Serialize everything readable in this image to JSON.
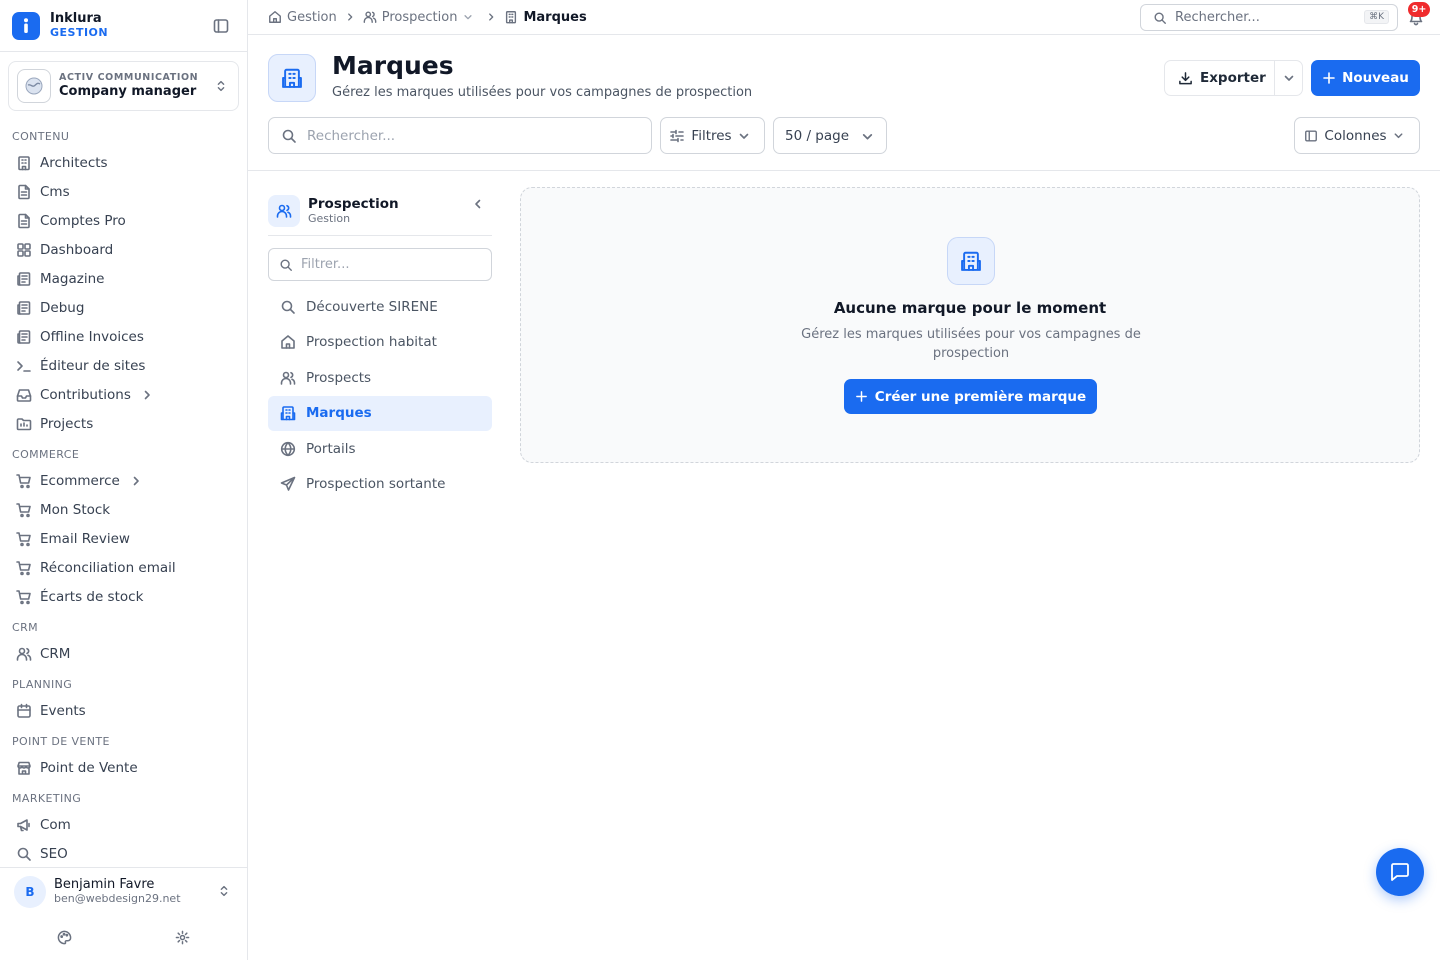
{
  "brand": {
    "name": "Inklura",
    "sub": "GESTION",
    "accent": "#1a6bf0"
  },
  "org": {
    "label": "ACTIV COMMUNICATION",
    "name": "Company manager"
  },
  "sidebar": {
    "sections": [
      {
        "title": "CONTENU",
        "items": [
          {
            "label": "Architects",
            "icon": "building-icon"
          },
          {
            "label": "Cms",
            "icon": "file-icon"
          },
          {
            "label": "Comptes Pro",
            "icon": "file-icon"
          },
          {
            "label": "Dashboard",
            "icon": "grid-icon"
          },
          {
            "label": "Magazine",
            "icon": "newspaper-icon"
          },
          {
            "label": "Debug",
            "icon": "newspaper-icon"
          },
          {
            "label": "Offline Invoices",
            "icon": "newspaper-icon"
          },
          {
            "label": "Éditeur de sites",
            "icon": "terminal-icon"
          },
          {
            "label": "Contributions",
            "icon": "inbox-icon",
            "chevron": true
          },
          {
            "label": "Projects",
            "icon": "folder-icon"
          }
        ]
      },
      {
        "title": "COMMERCE",
        "items": [
          {
            "label": "Ecommerce",
            "icon": "cart-icon",
            "chevron": true
          },
          {
            "label": "Mon Stock",
            "icon": "cart-icon"
          },
          {
            "label": "Email Review",
            "icon": "cart-icon"
          },
          {
            "label": "Réconciliation email",
            "icon": "cart-icon"
          },
          {
            "label": "Écarts de stock",
            "icon": "cart-icon"
          }
        ]
      },
      {
        "title": "CRM",
        "items": [
          {
            "label": "CRM",
            "icon": "users-icon"
          }
        ]
      },
      {
        "title": "PLANNING",
        "items": [
          {
            "label": "Events",
            "icon": "calendar-icon"
          }
        ]
      },
      {
        "title": "POINT DE VENTE",
        "items": [
          {
            "label": "Point de Vente",
            "icon": "store-icon"
          }
        ]
      },
      {
        "title": "MARKETING",
        "items": [
          {
            "label": "Com",
            "icon": "megaphone-icon"
          },
          {
            "label": "SEO",
            "icon": "search-icon"
          }
        ]
      }
    ]
  },
  "user": {
    "initial": "B",
    "name": "Benjamin Favre",
    "email": "ben@webdesign29.net"
  },
  "breadcrumb": [
    {
      "label": "Gestion",
      "icon": "home-icon"
    },
    {
      "label": "Prospection",
      "icon": "users-icon",
      "dropdown": true
    },
    {
      "label": "Marques",
      "icon": "building-icon"
    }
  ],
  "top_search": {
    "placeholder": "Rechercher...",
    "shortcut": "⌘K"
  },
  "notifications": {
    "badge": "9+"
  },
  "page": {
    "title": "Marques",
    "subtitle": "Gérez les marques utilisées pour vos campagnes de prospection",
    "export_label": "Exporter",
    "new_label": "Nouveau",
    "search_placeholder": "Rechercher...",
    "filters_label": "Filtres",
    "page_size": "50 / page",
    "columns_label": "Colonnes"
  },
  "subnav": {
    "title": "Prospection",
    "sub": "Gestion",
    "filter_placeholder": "Filtrer...",
    "items": [
      {
        "label": "Découverte SIRENE",
        "icon": "search-icon"
      },
      {
        "label": "Prospection habitat",
        "icon": "home-icon"
      },
      {
        "label": "Prospects",
        "icon": "users-icon"
      },
      {
        "label": "Marques",
        "icon": "building-icon",
        "active": true
      },
      {
        "label": "Portails",
        "icon": "globe-icon"
      },
      {
        "label": "Prospection sortante",
        "icon": "send-icon"
      }
    ]
  },
  "empty_state": {
    "title": "Aucune marque pour le moment",
    "description": "Gérez les marques utilisées pour vos campagnes de prospection",
    "cta": "Créer une première marque"
  }
}
